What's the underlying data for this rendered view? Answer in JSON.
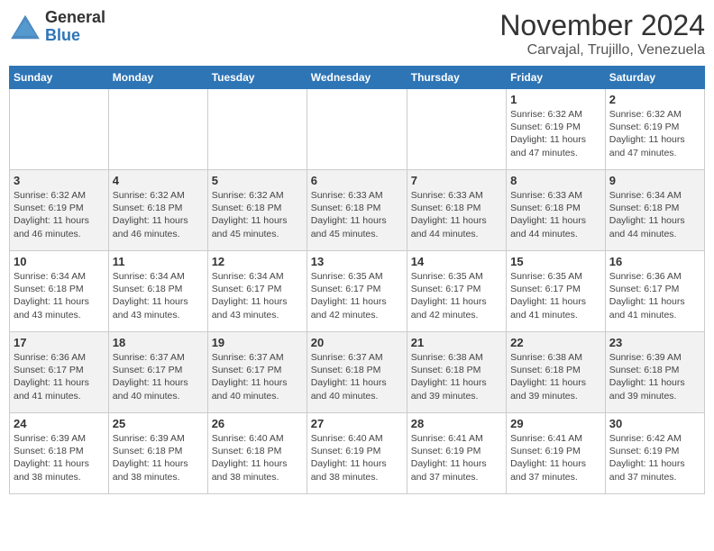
{
  "logo": {
    "general": "General",
    "blue": "Blue"
  },
  "title": "November 2024",
  "subtitle": "Carvajal, Trujillo, Venezuela",
  "days_of_week": [
    "Sunday",
    "Monday",
    "Tuesday",
    "Wednesday",
    "Thursday",
    "Friday",
    "Saturday"
  ],
  "weeks": [
    [
      {
        "day": "",
        "info": ""
      },
      {
        "day": "",
        "info": ""
      },
      {
        "day": "",
        "info": ""
      },
      {
        "day": "",
        "info": ""
      },
      {
        "day": "",
        "info": ""
      },
      {
        "day": "1",
        "info": "Sunrise: 6:32 AM\nSunset: 6:19 PM\nDaylight: 11 hours\nand 47 minutes."
      },
      {
        "day": "2",
        "info": "Sunrise: 6:32 AM\nSunset: 6:19 PM\nDaylight: 11 hours\nand 47 minutes."
      }
    ],
    [
      {
        "day": "3",
        "info": "Sunrise: 6:32 AM\nSunset: 6:19 PM\nDaylight: 11 hours\nand 46 minutes."
      },
      {
        "day": "4",
        "info": "Sunrise: 6:32 AM\nSunset: 6:18 PM\nDaylight: 11 hours\nand 46 minutes."
      },
      {
        "day": "5",
        "info": "Sunrise: 6:32 AM\nSunset: 6:18 PM\nDaylight: 11 hours\nand 45 minutes."
      },
      {
        "day": "6",
        "info": "Sunrise: 6:33 AM\nSunset: 6:18 PM\nDaylight: 11 hours\nand 45 minutes."
      },
      {
        "day": "7",
        "info": "Sunrise: 6:33 AM\nSunset: 6:18 PM\nDaylight: 11 hours\nand 44 minutes."
      },
      {
        "day": "8",
        "info": "Sunrise: 6:33 AM\nSunset: 6:18 PM\nDaylight: 11 hours\nand 44 minutes."
      },
      {
        "day": "9",
        "info": "Sunrise: 6:34 AM\nSunset: 6:18 PM\nDaylight: 11 hours\nand 44 minutes."
      }
    ],
    [
      {
        "day": "10",
        "info": "Sunrise: 6:34 AM\nSunset: 6:18 PM\nDaylight: 11 hours\nand 43 minutes."
      },
      {
        "day": "11",
        "info": "Sunrise: 6:34 AM\nSunset: 6:18 PM\nDaylight: 11 hours\nand 43 minutes."
      },
      {
        "day": "12",
        "info": "Sunrise: 6:34 AM\nSunset: 6:17 PM\nDaylight: 11 hours\nand 43 minutes."
      },
      {
        "day": "13",
        "info": "Sunrise: 6:35 AM\nSunset: 6:17 PM\nDaylight: 11 hours\nand 42 minutes."
      },
      {
        "day": "14",
        "info": "Sunrise: 6:35 AM\nSunset: 6:17 PM\nDaylight: 11 hours\nand 42 minutes."
      },
      {
        "day": "15",
        "info": "Sunrise: 6:35 AM\nSunset: 6:17 PM\nDaylight: 11 hours\nand 41 minutes."
      },
      {
        "day": "16",
        "info": "Sunrise: 6:36 AM\nSunset: 6:17 PM\nDaylight: 11 hours\nand 41 minutes."
      }
    ],
    [
      {
        "day": "17",
        "info": "Sunrise: 6:36 AM\nSunset: 6:17 PM\nDaylight: 11 hours\nand 41 minutes."
      },
      {
        "day": "18",
        "info": "Sunrise: 6:37 AM\nSunset: 6:17 PM\nDaylight: 11 hours\nand 40 minutes."
      },
      {
        "day": "19",
        "info": "Sunrise: 6:37 AM\nSunset: 6:17 PM\nDaylight: 11 hours\nand 40 minutes."
      },
      {
        "day": "20",
        "info": "Sunrise: 6:37 AM\nSunset: 6:18 PM\nDaylight: 11 hours\nand 40 minutes."
      },
      {
        "day": "21",
        "info": "Sunrise: 6:38 AM\nSunset: 6:18 PM\nDaylight: 11 hours\nand 39 minutes."
      },
      {
        "day": "22",
        "info": "Sunrise: 6:38 AM\nSunset: 6:18 PM\nDaylight: 11 hours\nand 39 minutes."
      },
      {
        "day": "23",
        "info": "Sunrise: 6:39 AM\nSunset: 6:18 PM\nDaylight: 11 hours\nand 39 minutes."
      }
    ],
    [
      {
        "day": "24",
        "info": "Sunrise: 6:39 AM\nSunset: 6:18 PM\nDaylight: 11 hours\nand 38 minutes."
      },
      {
        "day": "25",
        "info": "Sunrise: 6:39 AM\nSunset: 6:18 PM\nDaylight: 11 hours\nand 38 minutes."
      },
      {
        "day": "26",
        "info": "Sunrise: 6:40 AM\nSunset: 6:18 PM\nDaylight: 11 hours\nand 38 minutes."
      },
      {
        "day": "27",
        "info": "Sunrise: 6:40 AM\nSunset: 6:19 PM\nDaylight: 11 hours\nand 38 minutes."
      },
      {
        "day": "28",
        "info": "Sunrise: 6:41 AM\nSunset: 6:19 PM\nDaylight: 11 hours\nand 37 minutes."
      },
      {
        "day": "29",
        "info": "Sunrise: 6:41 AM\nSunset: 6:19 PM\nDaylight: 11 hours\nand 37 minutes."
      },
      {
        "day": "30",
        "info": "Sunrise: 6:42 AM\nSunset: 6:19 PM\nDaylight: 11 hours\nand 37 minutes."
      }
    ]
  ]
}
